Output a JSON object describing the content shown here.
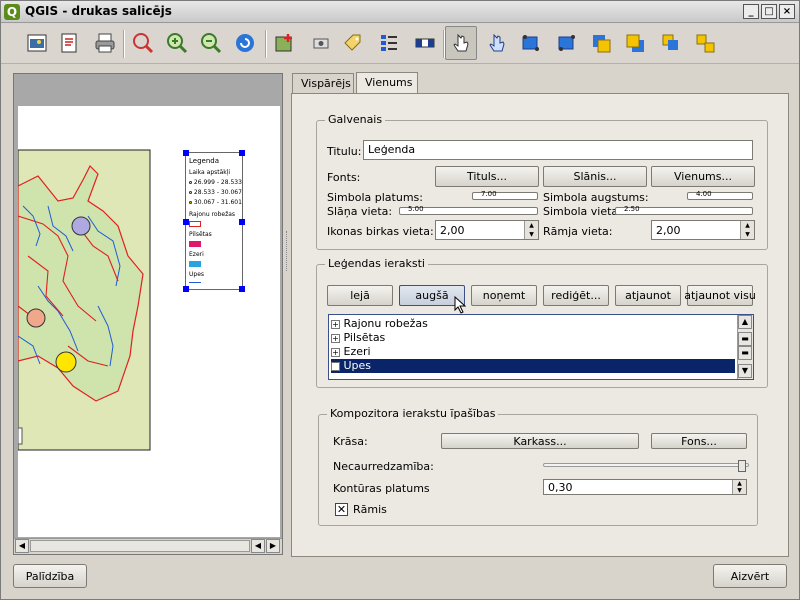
{
  "window": {
    "title": "QGIS - drukas salicējs"
  },
  "toolbar": {
    "icons": [
      "export-image-icon",
      "export-pdf-icon",
      "print-icon",
      "zoom-full-icon",
      "zoom-in-icon",
      "zoom-out-icon",
      "refresh-icon",
      "add-map-icon",
      "add-image-icon",
      "add-label-icon",
      "add-legend-icon",
      "add-scalebar-icon",
      "select-move-icon",
      "move-content-icon",
      "group-icon",
      "ungroup-icon",
      "raise-icon",
      "lower-icon",
      "move-top-icon",
      "move-bottom-icon"
    ]
  },
  "legend_preview": {
    "title": "Legenda",
    "subtitle": "Laika apstākļi",
    "items": [
      "26.999 - 28.533",
      "28.533 - 30.067",
      "30.067 - 31.601"
    ],
    "groups": [
      "Rajonu robežas",
      "Pilsētas",
      "Ezeri",
      "Upes"
    ]
  },
  "tabs": {
    "general": "Vispārējs",
    "item": "Vienums"
  },
  "main_group": {
    "title": "Galvenais",
    "title_label": "Titulu:",
    "title_value": "Leģenda",
    "fonts_label": "Fonts:",
    "btn_title": "Tituls...",
    "btn_layer": "Slānis...",
    "btn_item": "Vienums...",
    "symbol_width_label": "Simbola platums:",
    "symbol_height_label": "Simbola augstums:",
    "layer_space_label": "Slāņa vieta:",
    "symbol_space_label": "Simbola vieta:",
    "icon_label_space_label": "Ikonas birkas vieta:",
    "icon_label_space_value": "2,00",
    "box_space_label": "Rāmja vieta:",
    "box_space_value": "2,00",
    "symbol_width_value": "7.00",
    "symbol_height_value": "4.00",
    "layer_space_value": "5.00",
    "symbol_space_value": "2.50"
  },
  "entries_group": {
    "title": "Leģendas ieraksti",
    "buttons": [
      "lejā",
      "augšā",
      "noņemt",
      "rediģēt...",
      "atjaunot",
      "atjaunot visu"
    ],
    "tree_items": [
      "Rajonu robežas",
      "Pilsētas",
      "Ezeri",
      "Upes"
    ],
    "selected_index": 3
  },
  "composer_group": {
    "title": "Kompozitora ierakstu īpašības",
    "color_label": "Krāsa:",
    "btn_frame": "Karkass...",
    "btn_background": "Fons...",
    "opacity_label": "Necaurredzamība:",
    "opacity_percent": 100,
    "outline_label": "Kontūras platums",
    "outline_value": "0,30",
    "frame_label": "Rāmis",
    "frame_checked": true
  },
  "footer": {
    "help": "Palīdzība",
    "close": "Aizvērt"
  },
  "colors": {
    "selection": "#0a246a",
    "map_bg": "#dfe7b6",
    "border_red": "#e02020",
    "river_blue": "#1f5bd6"
  }
}
